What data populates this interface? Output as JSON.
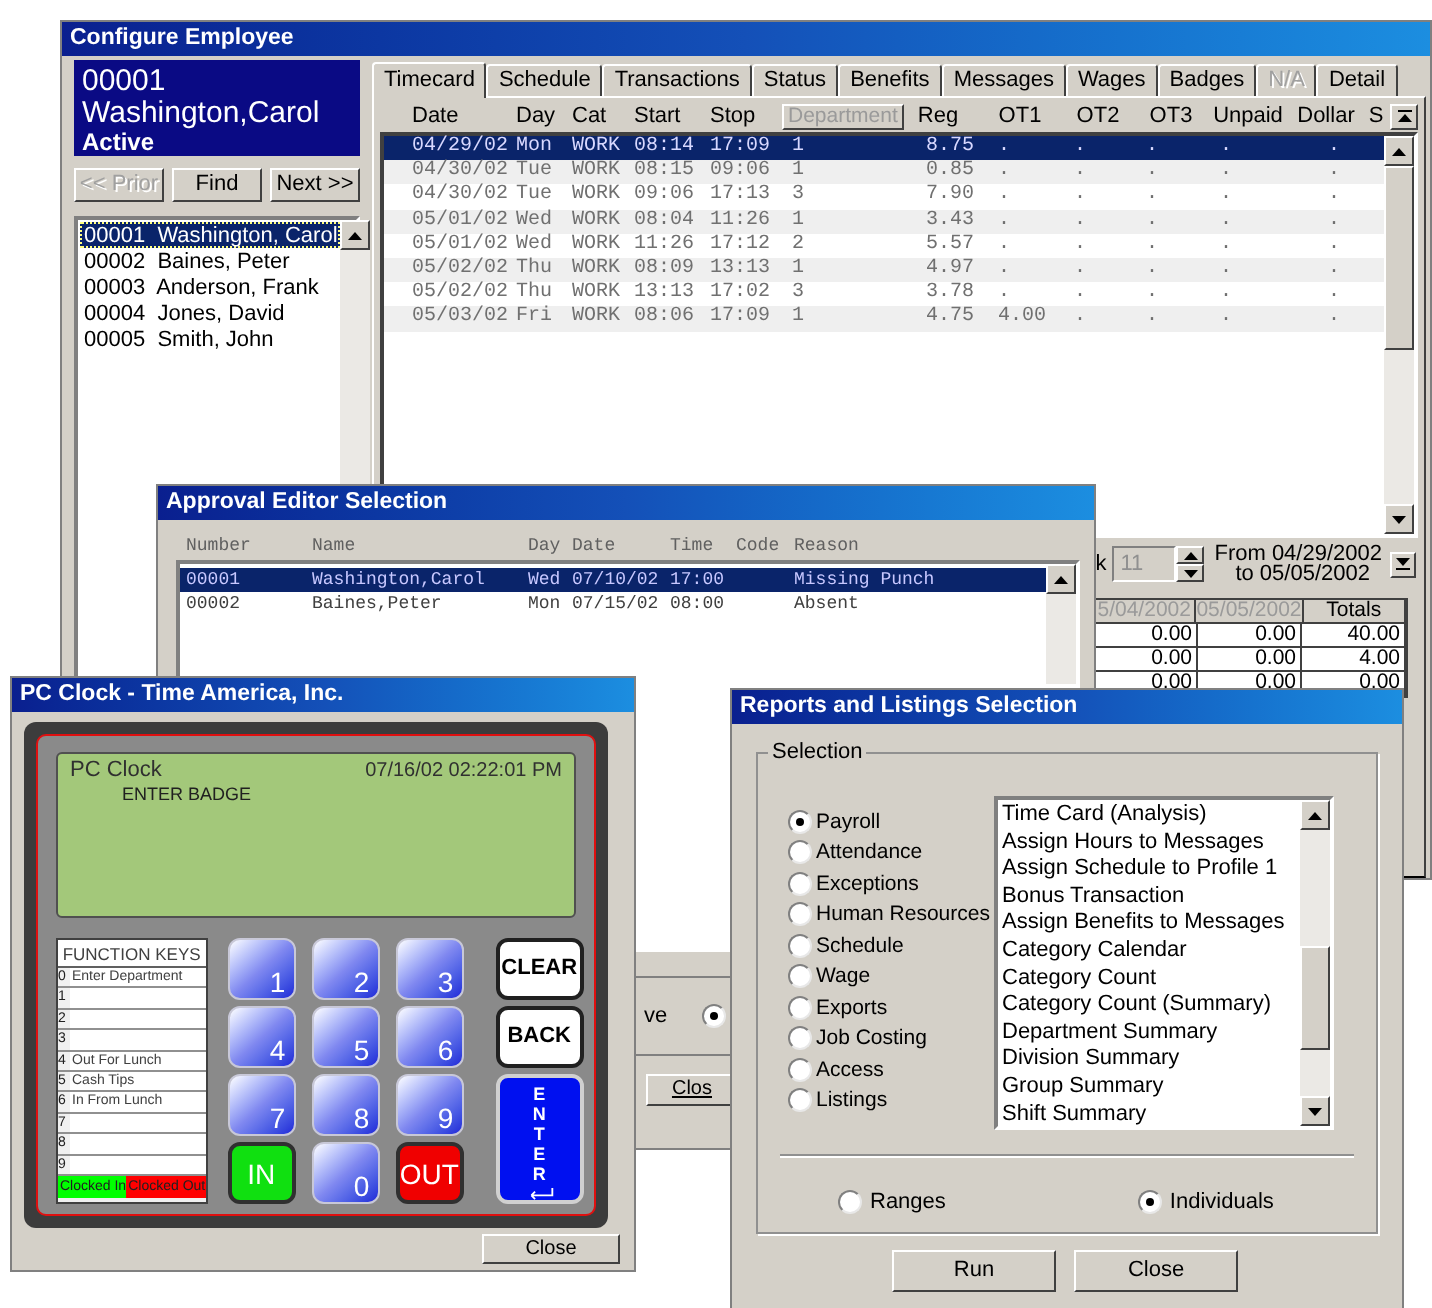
{
  "employee_window": {
    "title": "Configure Employee",
    "employee": {
      "number": "00001",
      "name": "Washington,Carol",
      "status": "Active"
    },
    "nav_buttons": [
      {
        "label": "<< Prior",
        "disabled": true
      },
      {
        "label": "Find",
        "disabled": false
      },
      {
        "label": "Next >>",
        "disabled": false
      }
    ],
    "employees": [
      {
        "number": "00001",
        "name": "Washington, Carol",
        "selected": true
      },
      {
        "number": "00002",
        "name": "Baines, Peter",
        "selected": false
      },
      {
        "number": "00003",
        "name": "Anderson, Frank",
        "selected": false
      },
      {
        "number": "00004",
        "name": "Jones, David",
        "selected": false
      },
      {
        "number": "00005",
        "name": "Smith, John",
        "selected": false
      }
    ],
    "tabs": [
      {
        "label": "Timecard",
        "selected": true,
        "disabled": false
      },
      {
        "label": "Schedule",
        "selected": false,
        "disabled": false
      },
      {
        "label": "Transactions",
        "selected": false,
        "disabled": false
      },
      {
        "label": "Status",
        "selected": false,
        "disabled": false
      },
      {
        "label": "Benefits",
        "selected": false,
        "disabled": false
      },
      {
        "label": "Messages",
        "selected": false,
        "disabled": false
      },
      {
        "label": "Wages",
        "selected": false,
        "disabled": false
      },
      {
        "label": "Badges",
        "selected": false,
        "disabled": false
      },
      {
        "label": "N/A",
        "selected": false,
        "disabled": true
      },
      {
        "label": "Detail",
        "selected": false,
        "disabled": false
      }
    ],
    "timecard": {
      "columns": [
        {
          "label": "Date",
          "kind": "text"
        },
        {
          "label": "Day",
          "kind": "text"
        },
        {
          "label": "Cat",
          "kind": "text"
        },
        {
          "label": "Start",
          "kind": "text"
        },
        {
          "label": "Stop",
          "kind": "text"
        },
        {
          "label": "Department",
          "kind": "button"
        },
        {
          "label": "Reg",
          "kind": "text"
        },
        {
          "label": "OT1",
          "kind": "text"
        },
        {
          "label": "OT2",
          "kind": "text"
        },
        {
          "label": "OT3",
          "kind": "text"
        },
        {
          "label": "Unpaid",
          "kind": "text"
        },
        {
          "label": "Dollar",
          "kind": "text"
        },
        {
          "label": "S",
          "kind": "text"
        }
      ],
      "rows": [
        {
          "cells": [
            "04/29/02",
            "Mon",
            "WORK",
            "08:14",
            "17:09",
            "1",
            "8.75",
            ".",
            ".",
            ".",
            ".",
            "."
          ],
          "selected": true
        },
        {
          "cells": [
            "04/30/02",
            "Tue",
            "WORK",
            "08:15",
            "09:06",
            "1",
            "0.85",
            ".",
            ".",
            ".",
            ".",
            "."
          ],
          "selected": false
        },
        {
          "cells": [
            "04/30/02",
            "Tue",
            "WORK",
            "09:06",
            "17:13",
            "3",
            "7.90",
            ".",
            ".",
            ".",
            ".",
            "."
          ],
          "selected": false
        },
        {
          "cells": [
            "05/01/02",
            "Wed",
            "WORK",
            "08:04",
            "11:26",
            "1",
            "3.43",
            ".",
            ".",
            ".",
            ".",
            "."
          ],
          "selected": false
        },
        {
          "cells": [
            "05/01/02",
            "Wed",
            "WORK",
            "11:26",
            "17:12",
            "2",
            "5.57",
            ".",
            ".",
            ".",
            ".",
            "."
          ],
          "selected": false
        },
        {
          "cells": [
            "05/02/02",
            "Thu",
            "WORK",
            "08:09",
            "13:13",
            "1",
            "4.97",
            ".",
            ".",
            ".",
            ".",
            "."
          ],
          "selected": false
        },
        {
          "cells": [
            "05/02/02",
            "Thu",
            "WORK",
            "13:13",
            "17:02",
            "3",
            "3.78",
            ".",
            ".",
            ".",
            ".",
            "."
          ],
          "selected": false
        },
        {
          "cells": [
            "05/03/02",
            "Fri",
            "WORK",
            "08:06",
            "17:09",
            "1",
            "4.75",
            "4.00",
            ".",
            ".",
            ".",
            "."
          ],
          "selected": false
        }
      ]
    },
    "week": {
      "label": "k",
      "value": "11",
      "from": "From 04/29/2002",
      "to": "to 05/05/2002"
    },
    "totals": {
      "columns": [
        {
          "label": "5/04/2002",
          "disabled": true
        },
        {
          "label": "05/05/2002",
          "disabled": true
        },
        {
          "label": "Totals",
          "disabled": false
        }
      ],
      "rows": [
        [
          "0.00",
          "0.00",
          "40.00"
        ],
        [
          "0.00",
          "0.00",
          "4.00"
        ],
        [
          "0.00",
          "0.00",
          "0.00"
        ]
      ]
    }
  },
  "approval_window": {
    "title": "Approval Editor Selection",
    "columns": [
      "Number",
      "Name",
      "Day",
      "Date",
      "Time",
      "Code",
      "Reason"
    ],
    "rows": [
      {
        "number": "00001",
        "name": "Washington,Carol",
        "day": "Wed",
        "date": "07/10/02",
        "time": "17:00",
        "reason": "Missing Punch",
        "selected": true
      },
      {
        "number": "00002",
        "name": "Baines,Peter",
        "day": "Mon",
        "date": "07/15/02",
        "time": "08:00",
        "reason": "Absent",
        "selected": false
      }
    ],
    "option_label": "ve",
    "option_selected": true,
    "close_button": "Clos"
  },
  "clock_window": {
    "title": "PC Clock - Time America, Inc.",
    "display": {
      "title": "PC Clock",
      "datetime": "07/16/02 02:22:01 PM",
      "prompt": "ENTER BADGE"
    },
    "function_keys": {
      "title": "FUNCTION KEYS",
      "rows": [
        {
          "key": "0",
          "label": "Enter Department"
        },
        {
          "key": "1"
        },
        {
          "key": "2"
        },
        {
          "key": "3"
        },
        {
          "key": "4",
          "label": "Out For Lunch"
        },
        {
          "key": "5",
          "label": "Cash Tips"
        },
        {
          "key": "6",
          "label": "In From Lunch"
        },
        {
          "key": "7"
        },
        {
          "key": "8"
        },
        {
          "key": "9"
        }
      ],
      "legend": [
        {
          "label": "Clocked In",
          "color": "#00ff00"
        },
        {
          "label": "Clocked Out",
          "color": "#ff0000"
        }
      ]
    },
    "keys": [
      {
        "label": "1",
        "kind": "digit"
      },
      {
        "label": "2",
        "kind": "digit"
      },
      {
        "label": "3",
        "kind": "digit"
      },
      {
        "label": "CLEAR",
        "kind": "clear"
      },
      {
        "label": "4",
        "kind": "digit"
      },
      {
        "label": "5",
        "kind": "digit"
      },
      {
        "label": "6",
        "kind": "digit"
      },
      {
        "label": "BACK",
        "kind": "back"
      },
      {
        "label": "7",
        "kind": "digit"
      },
      {
        "label": "8",
        "kind": "digit"
      },
      {
        "label": "9",
        "kind": "digit"
      },
      {
        "label": "IN",
        "kind": "in"
      },
      {
        "label": "0",
        "kind": "digit"
      },
      {
        "label": "OUT",
        "kind": "out"
      },
      {
        "label": "ENTER",
        "kind": "enter"
      }
    ],
    "close_button": "Close"
  },
  "reports_window": {
    "title": "Reports and Listings Selection",
    "group_label": "Selection",
    "categories": [
      {
        "label": "Payroll",
        "selected": true
      },
      {
        "label": "Attendance",
        "selected": false
      },
      {
        "label": "Exceptions",
        "selected": false
      },
      {
        "label": "Human Resources",
        "selected": false
      },
      {
        "label": "Schedule",
        "selected": false
      },
      {
        "label": "Wage",
        "selected": false
      },
      {
        "label": "Exports",
        "selected": false
      },
      {
        "label": "Job Costing",
        "selected": false
      },
      {
        "label": "Access",
        "selected": false
      },
      {
        "label": "Listings",
        "selected": false
      }
    ],
    "reports": [
      "Time Card (Analysis)",
      "Assign Hours to Messages",
      "Assign Schedule to Profile 1",
      "Bonus Transaction",
      "Assign Benefits to Messages",
      "Category Calendar",
      "Category Count",
      "Category Count (Summary)",
      "Department Summary",
      "Division Summary",
      "Group Summary",
      "Shift Summary"
    ],
    "scope": [
      {
        "label": "Ranges",
        "selected": false
      },
      {
        "label": "Individuals",
        "selected": true
      }
    ],
    "buttons": [
      "Run",
      "Close"
    ]
  }
}
